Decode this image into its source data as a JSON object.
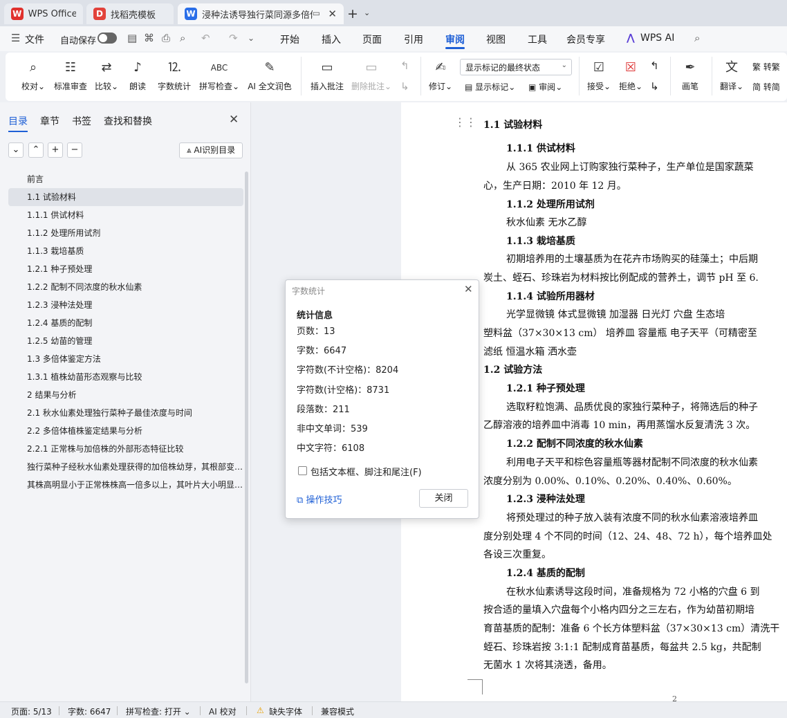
{
  "tabs": [
    {
      "label": "WPS Office",
      "logo": "W"
    },
    {
      "label": "找稻壳模板",
      "logo": "D"
    },
    {
      "label": "浸种法诱导独行菜同源多倍体",
      "logo": "W"
    }
  ],
  "menu": {
    "file": "文件",
    "autosave": "自动保存",
    "items": [
      "开始",
      "插入",
      "页面",
      "引用",
      "审阅",
      "视图",
      "工具",
      "会员专享"
    ],
    "ai": "WPS AI"
  },
  "ribbon": {
    "proofread": "校对",
    "std_review": "标准审查",
    "compare": "比较",
    "read_aloud": "朗读",
    "word_count": "字数统计",
    "spell_check": "拼写检查",
    "ai_polish": "AI 全文润色",
    "insert_comment": "插入批注",
    "delete_comment": "删除批注",
    "revise": "修订",
    "markup_state": "显示标记的最终状态",
    "show_markup": "显示标记",
    "review_pane": "审阅",
    "accept": "接受",
    "reject": "拒绝",
    "pen": "画笔",
    "translate": "翻译",
    "to_traditional": "转繁",
    "to_simplified": "转简"
  },
  "nav_panel": {
    "tabs": [
      "目录",
      "章节",
      "书签",
      "查找和替换"
    ],
    "ai_toc": "AI识别目录",
    "toc": [
      "前言",
      "1.1  试验材料",
      "1.1.1  供试材料",
      "1.1.2  处理所用试剂",
      "1.1.3  栽培基质",
      "1.2.1  种子预处理",
      "1.2.2  配制不同浓度的秋水仙素",
      "1.2.3  浸种法处理",
      "1.2.4  基质的配制",
      "1.2.5  幼苗的管理",
      "1.3  多倍体鉴定方法",
      "1.3.1  植株幼苗形态观察与比较",
      "2 结果与分析",
      "2.1  秋水仙素处理独行菜种子最佳浓度与时间",
      "2.2  多倍体植株鉴定结果与分析",
      "2.2.1  正常株与加倍株的外部形态特征比较",
      "独行菜种子经秋水仙素处理获得的加倍株幼芽，其根部变粗，叶片颜色加深",
      "其株高明显小于正常株株高一倍多以上，其叶片大小明显增大"
    ]
  },
  "document": {
    "lines": [
      "1.1  试验材料",
      "1.1.1  供试材料",
      "从 365 农业网上订购家独行菜种子，生产单位是国家蔬菜",
      "心，生产日期：2010 年 12 月。",
      "1.1.2  处理所用试剂",
      "秋水仙素   无水乙醇",
      "1.1.3  栽培基质",
      "初期培养用的土壤基质为在花卉市场购买的硅藻土；中后期",
      "炭土、蛭石、珍珠岩为材料按比例配成的营养土，调节 pH 至 6.",
      "1.1.4  试验所用器材",
      "光学显微镜   体式显微镜   加湿器   日光灯   穴盘   生态培",
      "塑料盆（37×30×13 cm）   培养皿   容量瓶   电子天平（可精密至",
      "滤纸   恒温水箱   洒水壶",
      "1.2  试验方法",
      "1.2.1  种子预处理",
      "选取籽粒饱满、品质优良的家独行菜种子，将筛选后的种子",
      "乙醇溶液的培养皿中消毒 10 min，再用蒸馏水反复清洗 3 次。",
      "1.2.2  配制不同浓度的秋水仙素",
      "利用电子天平和棕色容量瓶等器材配制不同浓度的秋水仙素",
      "浓度分别为 0.00%、0.10%、0.20%、0.40%、0.60%。",
      "1.2.3  浸种法处理",
      "将预处理过的种子放入装有浓度不同的秋水仙素溶液培养皿",
      "度分别处理 4 个不同的时间（12、24、48、72 h），每个培养皿处",
      "各设三次重复。",
      "1.2.4  基质的配制",
      "在秋水仙素诱导这段时间，准备规格为 72 小格的穴盘 6 到",
      "按合适的量填入穴盘每个小格内四分之三左右，作为幼苗初期培",
      "育苗基质的配制：准备 6 个长方体塑料盆（37×30×13 cm）清洗干",
      "蛭石、珍珠岩按 3:1:1 配制成育苗基质，每盆共 2.5 kg，共配制",
      "无菌水 1 次将其浇透，备用。"
    ],
    "page_number": "2"
  },
  "dialog": {
    "title": "字数统计",
    "section": "统计信息",
    "stats": [
      "页数：13",
      "字数：6647",
      "字符数(不计空格)：8204",
      "字符数(计空格)：8731",
      "段落数：211",
      "非中文单词：539",
      "中文字符：6108"
    ],
    "checkbox_label": "包括文本框、脚注和尾注(F)",
    "tips": "操作技巧",
    "close_button": "关闭"
  },
  "status": {
    "page": "页面: 5/13",
    "words": "字数: 6647",
    "spell": "拼写检查: 打开",
    "ai_proof": "AI 校对",
    "missing_font": "缺失字体",
    "compat": "兼容模式"
  },
  "colors": {
    "accent": "#1e5fd6",
    "wps_red": "#e0312d",
    "docer_red": "#e2423b",
    "doc_blue": "#2a6ee8"
  }
}
